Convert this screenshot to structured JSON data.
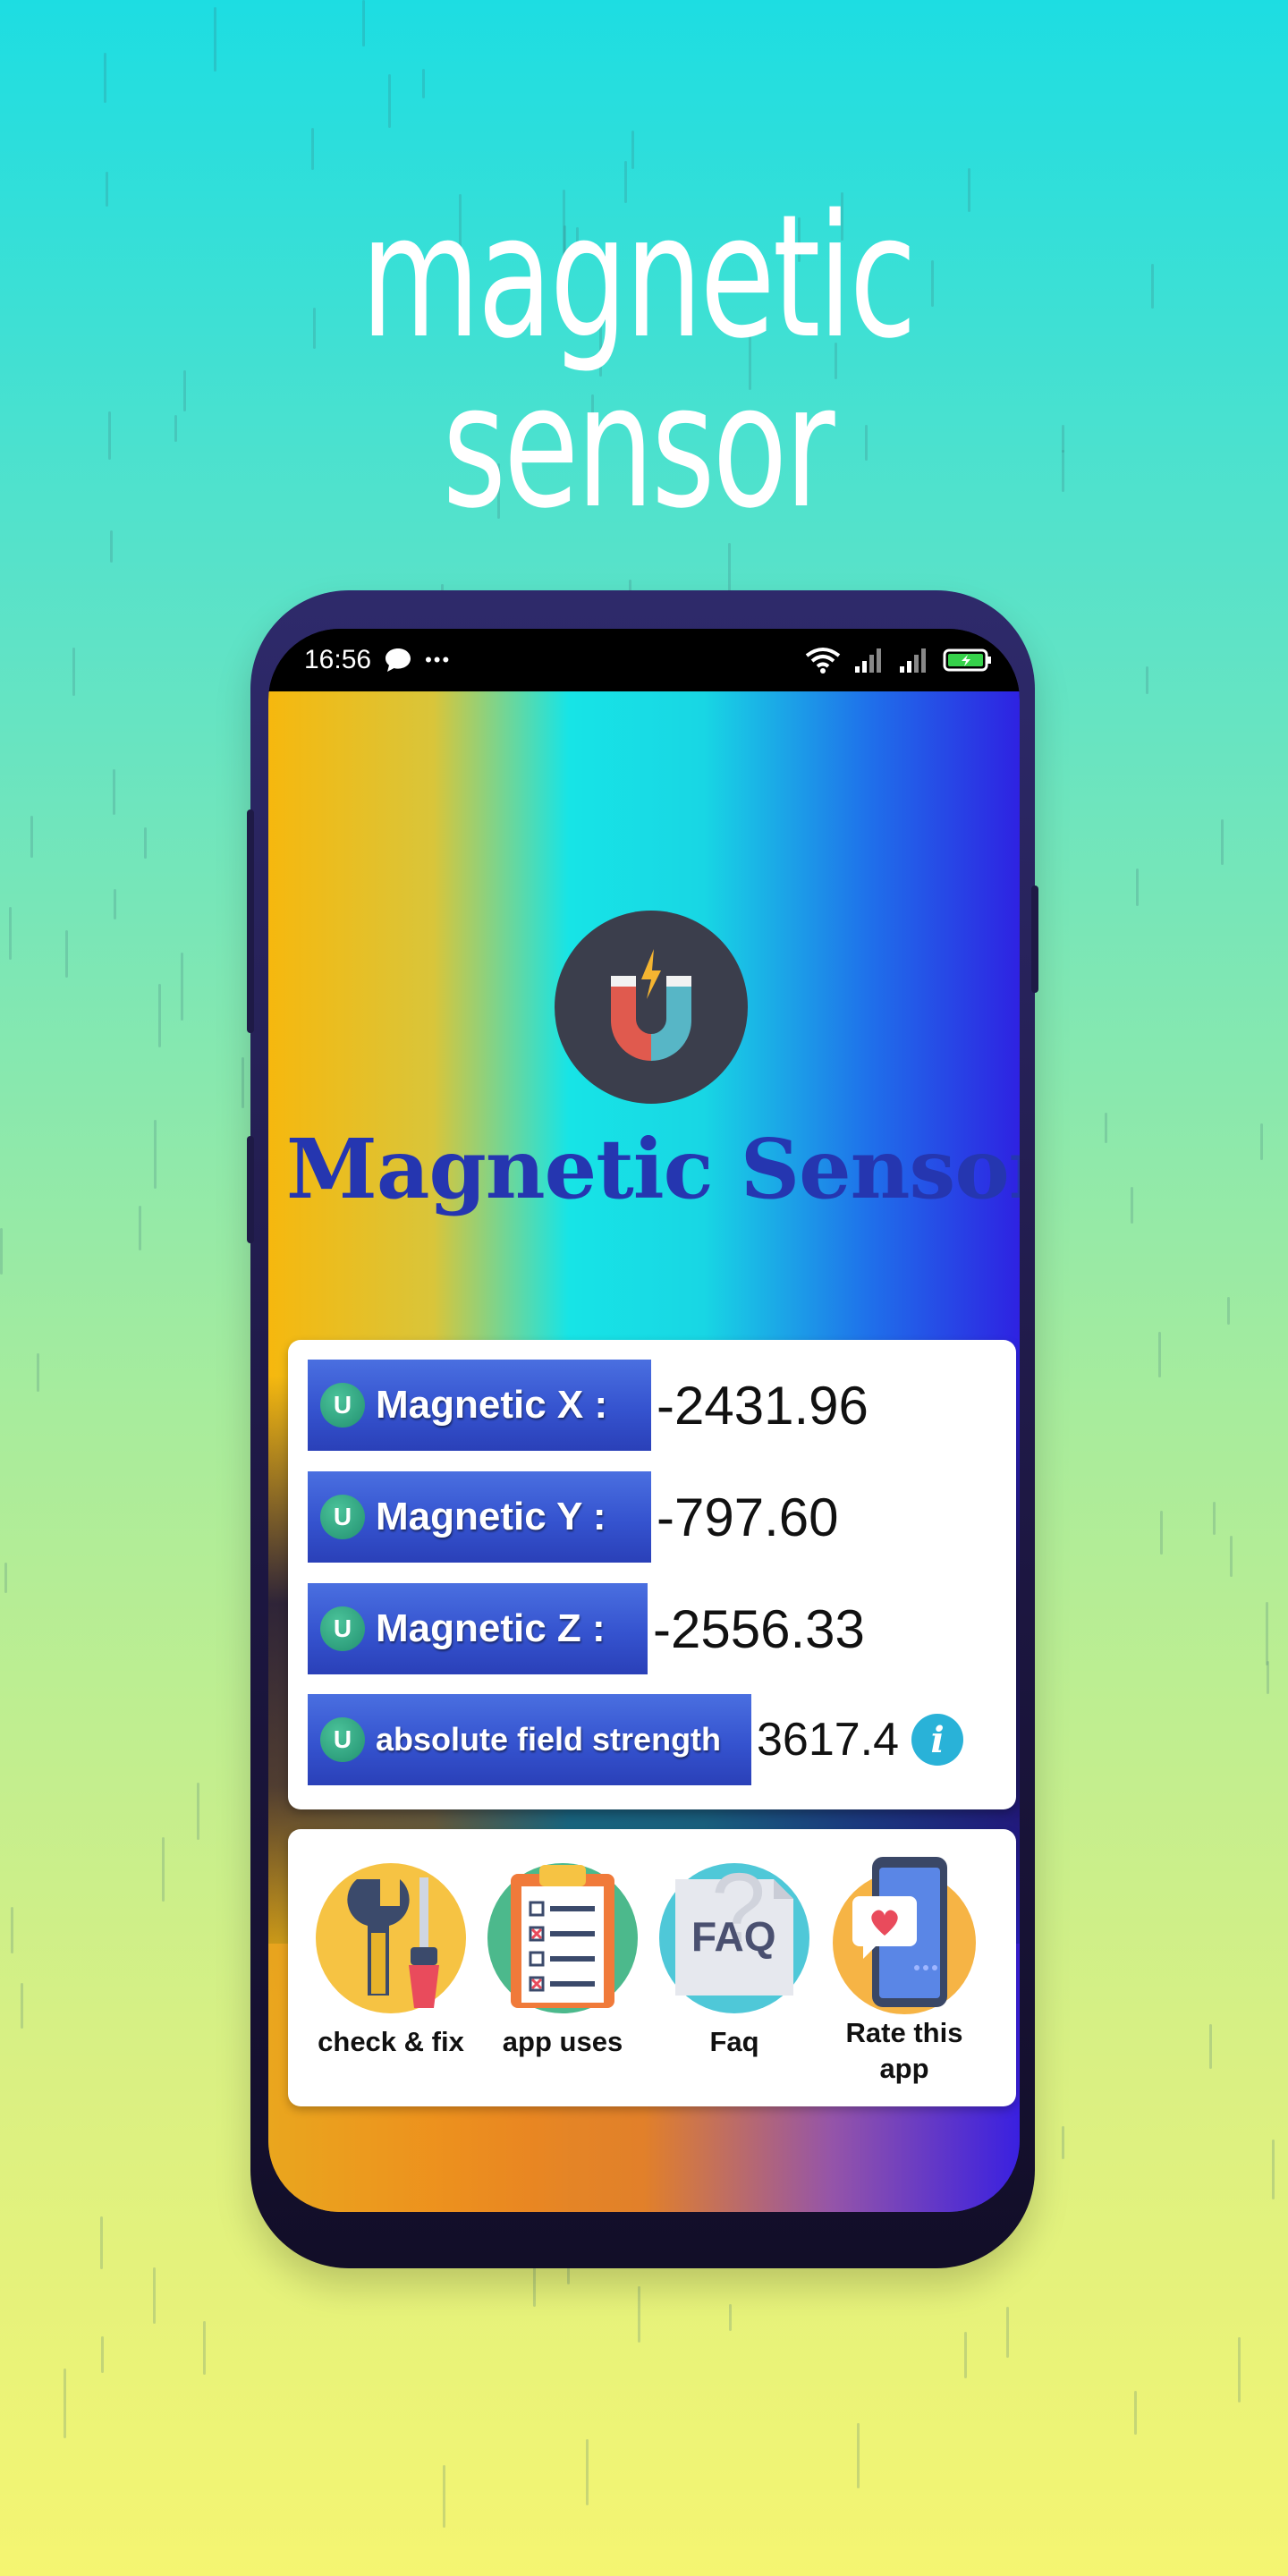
{
  "headline": "magnetic sensor",
  "statusbar": {
    "time": "16:56",
    "dots": "•••"
  },
  "app": {
    "title": "Magnetic Sensor"
  },
  "readings": [
    {
      "label": "Magnetic X :",
      "value": "-2431.96"
    },
    {
      "label": "Magnetic Y :",
      "value": "-797.60"
    },
    {
      "label": "Magnetic Z :",
      "value": "-2556.33"
    },
    {
      "label": "absolute field strength",
      "value": "3617.4"
    }
  ],
  "badge_letter": "U",
  "info_glyph": "i",
  "faq_text": "FAQ",
  "actions": [
    {
      "label": "check & fix",
      "icon": "wrench-screwdriver-icon"
    },
    {
      "label": "app uses",
      "icon": "clipboard-checklist-icon"
    },
    {
      "label": "Faq",
      "icon": "faq-icon"
    },
    {
      "label": "Rate this app",
      "icon": "phone-heart-icon"
    }
  ],
  "colors": {
    "title": "#2536b0",
    "label_bg": "#3553cf",
    "badge": "#229070",
    "info": "#29b2d8"
  }
}
